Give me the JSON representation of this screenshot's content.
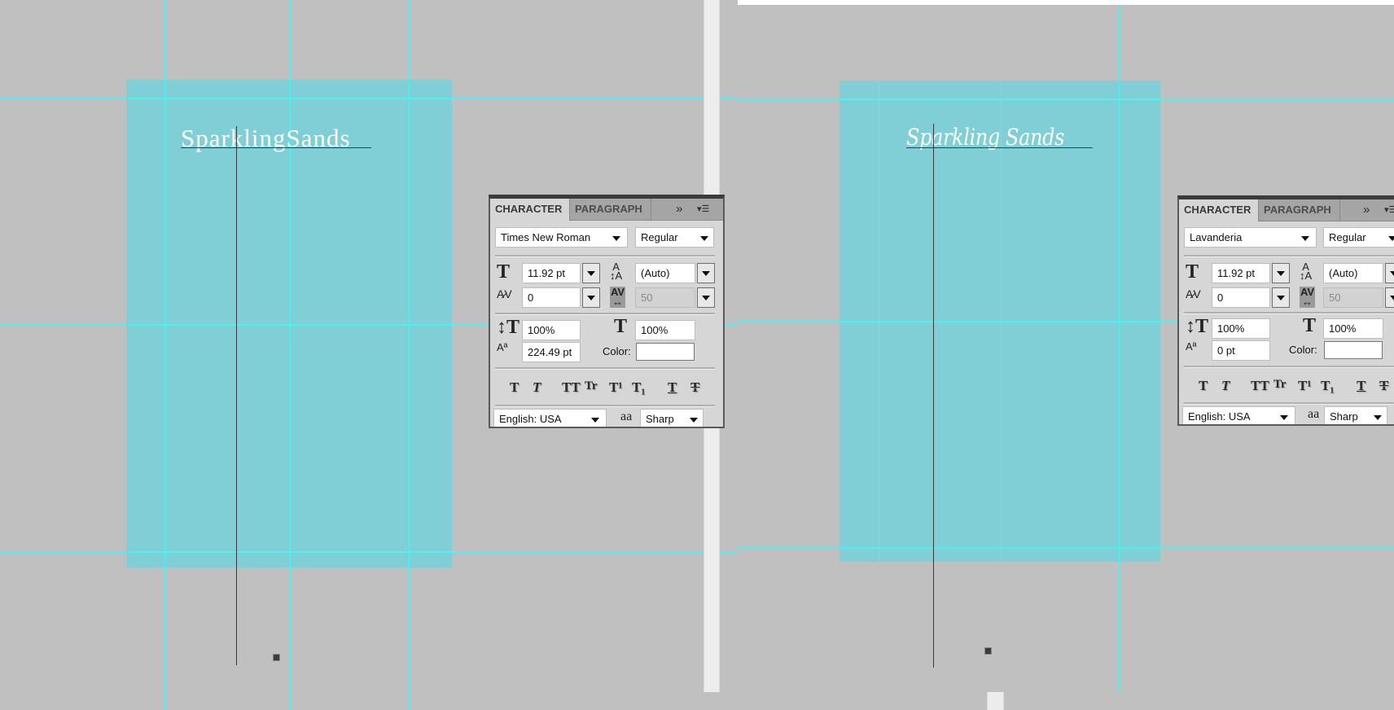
{
  "left_document": {
    "canvas_text": "SparklingSands",
    "panel": {
      "tabs": [
        {
          "label": "CHARACTER",
          "active": true
        },
        {
          "label": "PARAGRAPH",
          "active": false
        }
      ],
      "font_family": "Times New Roman",
      "font_style": "Regular",
      "font_size": "11.92 pt",
      "leading": "(Auto)",
      "kerning": "0",
      "tracking": "50",
      "vertical_scale": "100%",
      "horizontal_scale": "100%",
      "baseline_shift": "224.49 pt",
      "color_label": "Color:",
      "language": "English: USA",
      "antialiasing": "Sharp"
    }
  },
  "right_document": {
    "canvas_text": "Sparkling Sands",
    "panel": {
      "tabs": [
        {
          "label": "CHARACTER",
          "active": true
        },
        {
          "label": "PARAGRAPH",
          "active": false
        }
      ],
      "font_family": "Lavanderia",
      "font_style": "Regular",
      "font_size": "11.92 pt",
      "leading": "(Auto)",
      "kerning": "0",
      "tracking": "50",
      "vertical_scale": "100%",
      "horizontal_scale": "100%",
      "baseline_shift": "0 pt",
      "color_label": "Color:",
      "language": "English: USA",
      "antialiasing": "Sharp"
    }
  },
  "icons": {
    "panel_expand": "»",
    "panel_menu": "▾☰",
    "font_size_icon": "T",
    "aa_icon": "aa",
    "style_buttons": [
      "T",
      "T",
      "TT",
      "Tr",
      "T¹",
      "T₁",
      "T",
      "T"
    ]
  },
  "colors": {
    "artboard": "#80cfd7",
    "guide": "#4ff0f2",
    "workspace": "#c0c0c0",
    "panel_bg": "#d6d6d6"
  }
}
